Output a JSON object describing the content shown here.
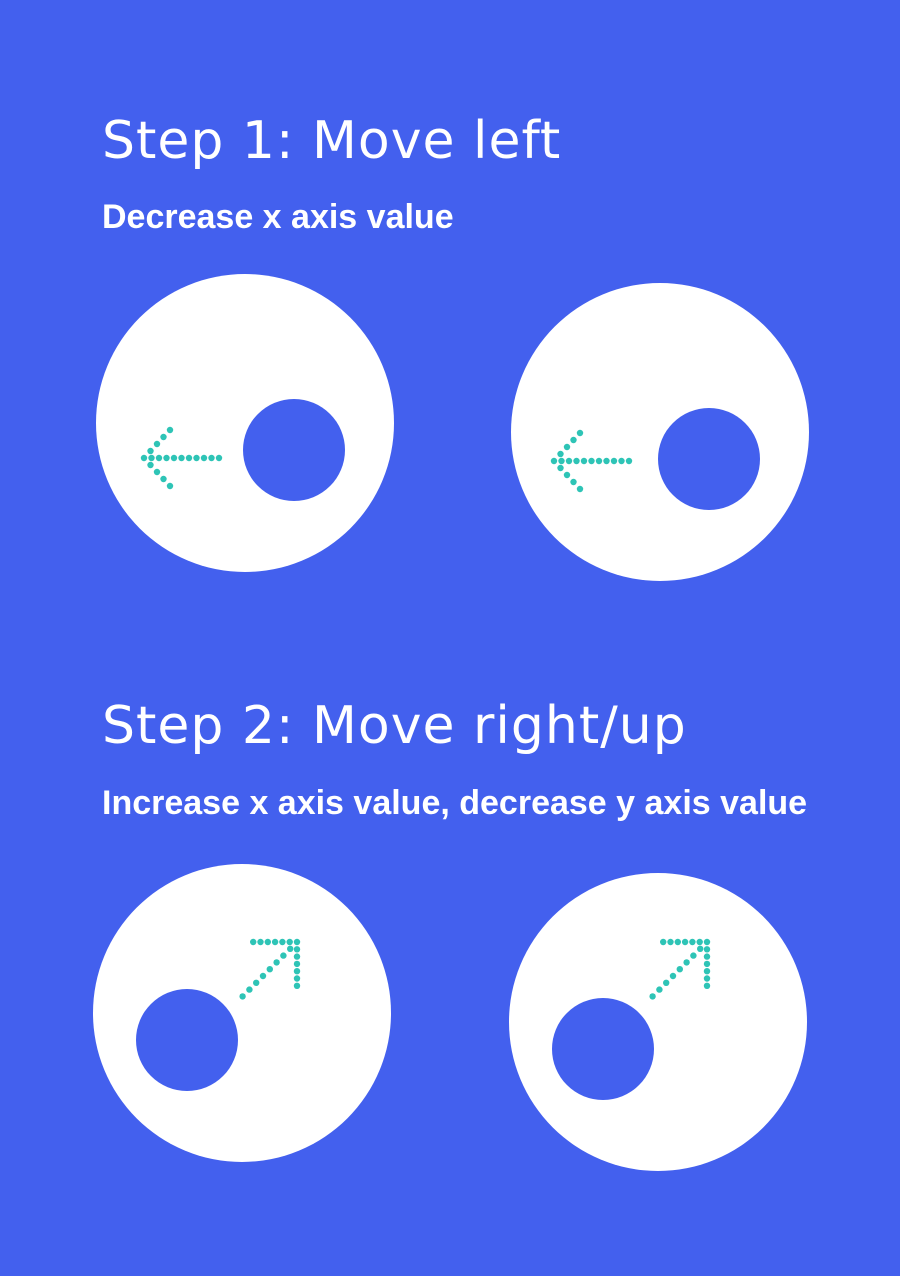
{
  "steps": [
    {
      "title": "Step 1: Move left",
      "description": "Decrease x axis value",
      "arrow_direction": "left"
    },
    {
      "title": "Step 2: Move right/up",
      "description": "Increase x axis value, decrease y axis value",
      "arrow_direction": "up-right"
    }
  ],
  "colors": {
    "background": "#4360EE",
    "joystick_base": "#FFFFFF",
    "joystick_knob": "#4360EE",
    "arrow": "#2EC4B6"
  },
  "icons": {
    "joystick": "joystick-icon",
    "arrow_left": "dotted-arrow-left-icon",
    "arrow_up_right": "dotted-arrow-up-right-icon"
  }
}
